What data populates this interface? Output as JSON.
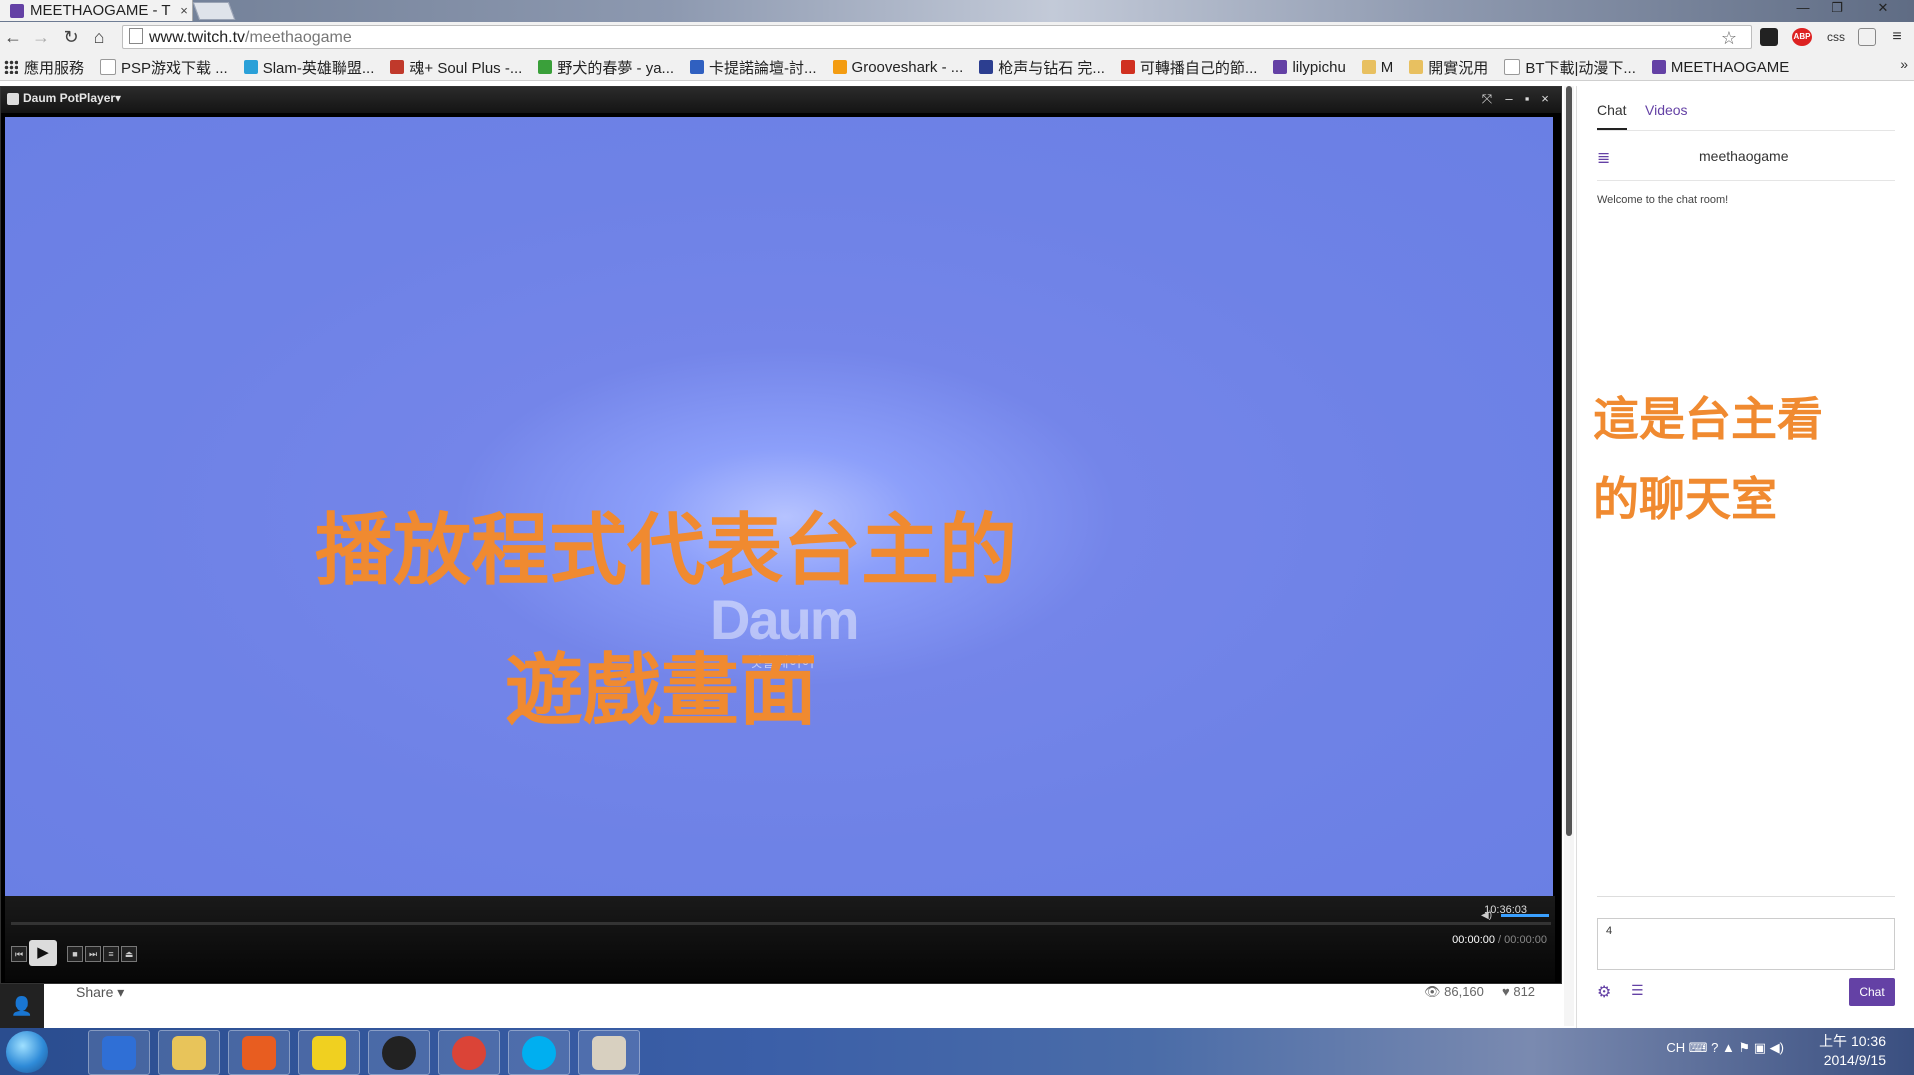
{
  "browser": {
    "tab_title": "MEETHAOGAME - T",
    "tab_close": "×",
    "url_host": "www.twitch.tv",
    "url_path": "/meethaogame",
    "window_minimize": "—",
    "window_maximize": "❐",
    "window_close": "✕",
    "ext_abp": "ABP",
    "ext_css": "css"
  },
  "bookmarks": [
    {
      "label": "應用服務",
      "color": "#333333"
    },
    {
      "label": "PSP游戏下载 ...",
      "color": "#ffffff"
    },
    {
      "label": "Slam-英雄聯盟...",
      "color": "#2aa0d8"
    },
    {
      "label": "魂+ Soul Plus -...",
      "color": "#c0392b"
    },
    {
      "label": "野犬的春夢 - ya...",
      "color": "#3aa03a"
    },
    {
      "label": "卡提諾論壇-討...",
      "color": "#3060c0"
    },
    {
      "label": "Grooveshark - ...",
      "color": "#f39c12"
    },
    {
      "label": "枪声与钻石 完...",
      "color": "#2c3e90"
    },
    {
      "label": "可轉播自己的節...",
      "color": "#d03020"
    },
    {
      "label": "lilypichu",
      "color": "#6441a5"
    },
    {
      "label": "M",
      "color": "#e8c060"
    },
    {
      "label": "開實況用",
      "color": "#e8c060"
    },
    {
      "label": "BT下載|动漫下...",
      "color": "#ffffff"
    },
    {
      "label": "MEETHAOGAME",
      "color": "#6441a5"
    }
  ],
  "bookmarks_overflow": "»",
  "player": {
    "name": "Daum PotPlayer▾",
    "logo_text": "Daum",
    "logo_sub": "팟플레이어",
    "clock": "10:36:03",
    "time_current": "00:00:00",
    "time_total": " / 00:00:00",
    "annotation_line1": "播放程式代表台主的",
    "annotation_line2": "遊戲畫面"
  },
  "stream": {
    "share_label": "Share ▾",
    "views": "86,160",
    "likes": "812"
  },
  "chat": {
    "tab_chat": "Chat",
    "tab_videos": "Videos",
    "channel": "meethaogame",
    "welcome": "Welcome to the chat room!",
    "input_value": "4",
    "send_label": "Chat",
    "annotation_line1": "這是台主看",
    "annotation_line2": "的聊天室"
  },
  "taskbar": {
    "lang": "CH",
    "time": "上午 10:36",
    "date": "2014/9/15",
    "apps": [
      {
        "name": "potplayer-live",
        "color": "#2f6fd6"
      },
      {
        "name": "file-explorer",
        "color": "#e8c45a"
      },
      {
        "name": "xsplit",
        "color": "#e85d20"
      },
      {
        "name": "yellow-app",
        "color": "#f0d020"
      },
      {
        "name": "obs",
        "color": "#222222"
      },
      {
        "name": "chrome",
        "color": "#db4437"
      },
      {
        "name": "skype",
        "color": "#00aff0"
      },
      {
        "name": "paint",
        "color": "#d8d0c0"
      }
    ]
  },
  "colors": {
    "twitch_purple": "#6441a5",
    "annotation_orange": "#f08a30",
    "video_bg": "#6a7fe4"
  }
}
